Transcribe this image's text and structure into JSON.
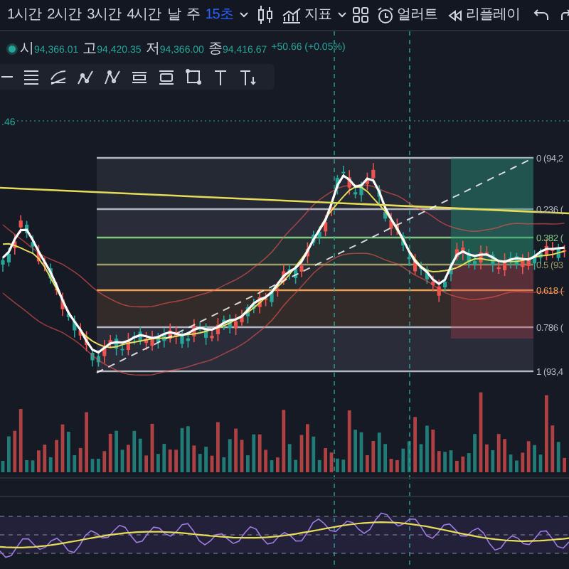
{
  "toolbar": {
    "intervals": [
      {
        "label": "1시간",
        "selected": false
      },
      {
        "label": "2시간",
        "selected": false
      },
      {
        "label": "3시간",
        "selected": false
      },
      {
        "label": "4시간",
        "selected": false
      },
      {
        "label": "날",
        "selected": false
      },
      {
        "label": "주",
        "selected": false
      },
      {
        "label": "15초",
        "selected": true
      }
    ],
    "indicators_label": "지표",
    "alert_label": "얼러트",
    "replay_label": "리플레이"
  },
  "legend": {
    "items": [
      {
        "label": "시",
        "value": "94,366.01"
      },
      {
        "label": "고",
        "value": "94,420.35"
      },
      {
        "label": "저",
        "value": "94,366.00"
      },
      {
        "label": "종",
        "value": "94,416.67"
      }
    ],
    "change": "+50.66 (+0.05%)"
  },
  "chart": {
    "price_label": ".46",
    "fib_levels": [
      {
        "label": "0 (94,2",
        "color": "#b2b5be"
      },
      {
        "label": "0.236 (",
        "color": "#b2b5be"
      },
      {
        "label": "0.382 (",
        "color": "#81c784"
      },
      {
        "label": "0.5 (93",
        "color": "#9e9e6a"
      },
      {
        "label": "0.618 (",
        "color": "#f0a050"
      },
      {
        "label": "0.786 (",
        "color": "#b2b5be"
      },
      {
        "label": "1 (93,4",
        "color": "#b2b5be"
      }
    ]
  }
}
